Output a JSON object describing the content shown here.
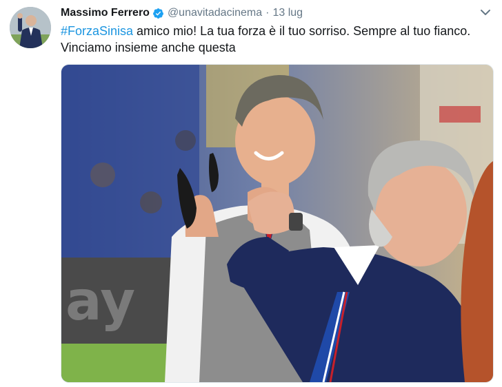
{
  "author": {
    "display_name": "Massimo Ferrero",
    "handle": "@unavitadacinema",
    "separator": "·",
    "timestamp": "13 lug",
    "verified_icon": "verified-badge-icon",
    "avatar_icon": "avatar"
  },
  "menu": {
    "icon": "chevron-down-icon"
  },
  "tweet": {
    "hashtag": "#ForzaSinisa",
    "text_after_hashtag": " amico mio! La tua forza è il tuo sorriso. Sempre al tuo fianco. Vinciamo insieme anche questa"
  },
  "media": {
    "billboard_text": "ay"
  },
  "colors": {
    "link": "#1b95e0",
    "verified": "#1da1f2",
    "secondary_text": "#657786"
  }
}
